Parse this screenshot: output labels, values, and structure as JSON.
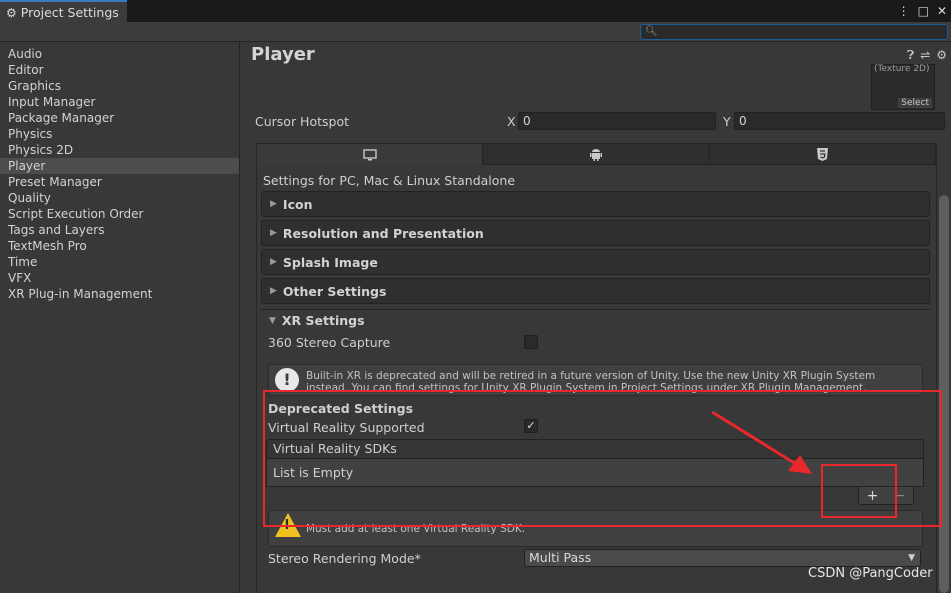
{
  "window": {
    "tab_title": "Project Settings",
    "controls": [
      "⋮",
      "□",
      "✕"
    ],
    "search_placeholder": ""
  },
  "sidebar": {
    "items": [
      {
        "label": "Audio",
        "selected": false
      },
      {
        "label": "Editor",
        "selected": false
      },
      {
        "label": "Graphics",
        "selected": false
      },
      {
        "label": "Input Manager",
        "selected": false
      },
      {
        "label": "Package Manager",
        "selected": false
      },
      {
        "label": "Physics",
        "selected": false
      },
      {
        "label": "Physics 2D",
        "selected": false
      },
      {
        "label": "Player",
        "selected": true
      },
      {
        "label": "Preset Manager",
        "selected": false
      },
      {
        "label": "Quality",
        "selected": false
      },
      {
        "label": "Script Execution Order",
        "selected": false
      },
      {
        "label": "Tags and Layers",
        "selected": false
      },
      {
        "label": "TextMesh Pro",
        "selected": false
      },
      {
        "label": "Time",
        "selected": false
      },
      {
        "label": "VFX",
        "selected": false
      },
      {
        "label": "XR Plug-in Management",
        "selected": false
      }
    ]
  },
  "main": {
    "title": "Player",
    "texture": {
      "type_label": "(Texture 2D)",
      "select_label": "Select"
    },
    "cursor_hotspot": {
      "label": "Cursor Hotspot",
      "x_label": "X",
      "x_value": "0",
      "y_label": "Y",
      "y_value": "0"
    },
    "platform_tabs": [
      {
        "name": "pc-standalone",
        "icon": "monitor-icon",
        "active": true
      },
      {
        "name": "android",
        "icon": "android-icon",
        "active": false
      },
      {
        "name": "webgl",
        "icon": "html5-icon",
        "active": false
      }
    ],
    "platform_title": "Settings for PC, Mac & Linux Standalone",
    "sections": [
      "Icon",
      "Resolution and Presentation",
      "Splash Image",
      "Other Settings"
    ],
    "xr": {
      "title": "XR Settings",
      "stereo_capture_label": "360 Stereo Capture",
      "stereo_capture_checked": false,
      "info_text": "Built-in XR is deprecated and will be retired in a future version of Unity. Use the new Unity XR Plugin System instead. You can find settings for Unity XR Plugin System in Project Settings under XR Plugin Management.",
      "deprecated_title": "Deprecated Settings",
      "vr_supported_label": "Virtual Reality Supported",
      "vr_supported_checked": true,
      "sdk_list_header": "Virtual Reality SDKs",
      "sdk_list_empty": "List is Empty",
      "add_label": "+",
      "remove_label": "−",
      "warning_text": "Must add at least one Virtual Reality SDK.",
      "stereo_mode_label": "Stereo Rendering Mode*",
      "stereo_mode_value": "Multi Pass"
    }
  },
  "watermark": "CSDN @PangCoder",
  "colors": {
    "selection": "#4d4d4d",
    "accent": "#3a79bb",
    "annotation": "#e8282a",
    "warning": "#f0c020"
  }
}
